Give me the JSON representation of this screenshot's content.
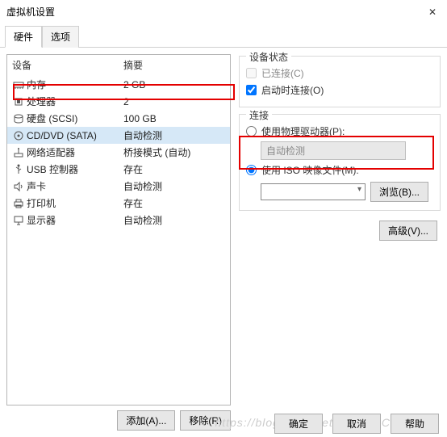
{
  "window": {
    "title": "虚拟机设置",
    "close": "✕"
  },
  "tabs": {
    "hardware": "硬件",
    "options": "选项"
  },
  "list": {
    "header_device": "设备",
    "header_summary": "摘要",
    "rows": [
      {
        "icon": "memory-icon",
        "name": "内存",
        "summary": "2 GB"
      },
      {
        "icon": "cpu-icon",
        "name": "处理器",
        "summary": "2"
      },
      {
        "icon": "disk-icon",
        "name": "硬盘 (SCSI)",
        "summary": "100 GB"
      },
      {
        "icon": "disc-icon",
        "name": "CD/DVD (SATA)",
        "summary": "自动检测"
      },
      {
        "icon": "network-icon",
        "name": "网络适配器",
        "summary": "桥接模式 (自动)"
      },
      {
        "icon": "usb-icon",
        "name": "USB 控制器",
        "summary": "存在"
      },
      {
        "icon": "sound-icon",
        "name": "声卡",
        "summary": "自动检测"
      },
      {
        "icon": "printer-icon",
        "name": "打印机",
        "summary": "存在"
      },
      {
        "icon": "display-icon",
        "name": "显示器",
        "summary": "自动检测"
      }
    ]
  },
  "left_buttons": {
    "add": "添加(A)...",
    "remove": "移除(R)"
  },
  "status_group": {
    "title": "设备状态",
    "connected": "已连接(C)",
    "connect_on": "启动时连接(O)"
  },
  "conn_group": {
    "title": "连接",
    "use_physical": "使用物理驱动器(P):",
    "auto_detect": "自动检测",
    "use_iso": "使用 ISO 映像文件(M):",
    "browse": "浏览(B)..."
  },
  "advanced": "高级(V)...",
  "footer": {
    "ok": "确定",
    "cancel": "取消",
    "help": "帮助"
  },
  "watermark": "https://blog.csdn.net/net@51C博客"
}
